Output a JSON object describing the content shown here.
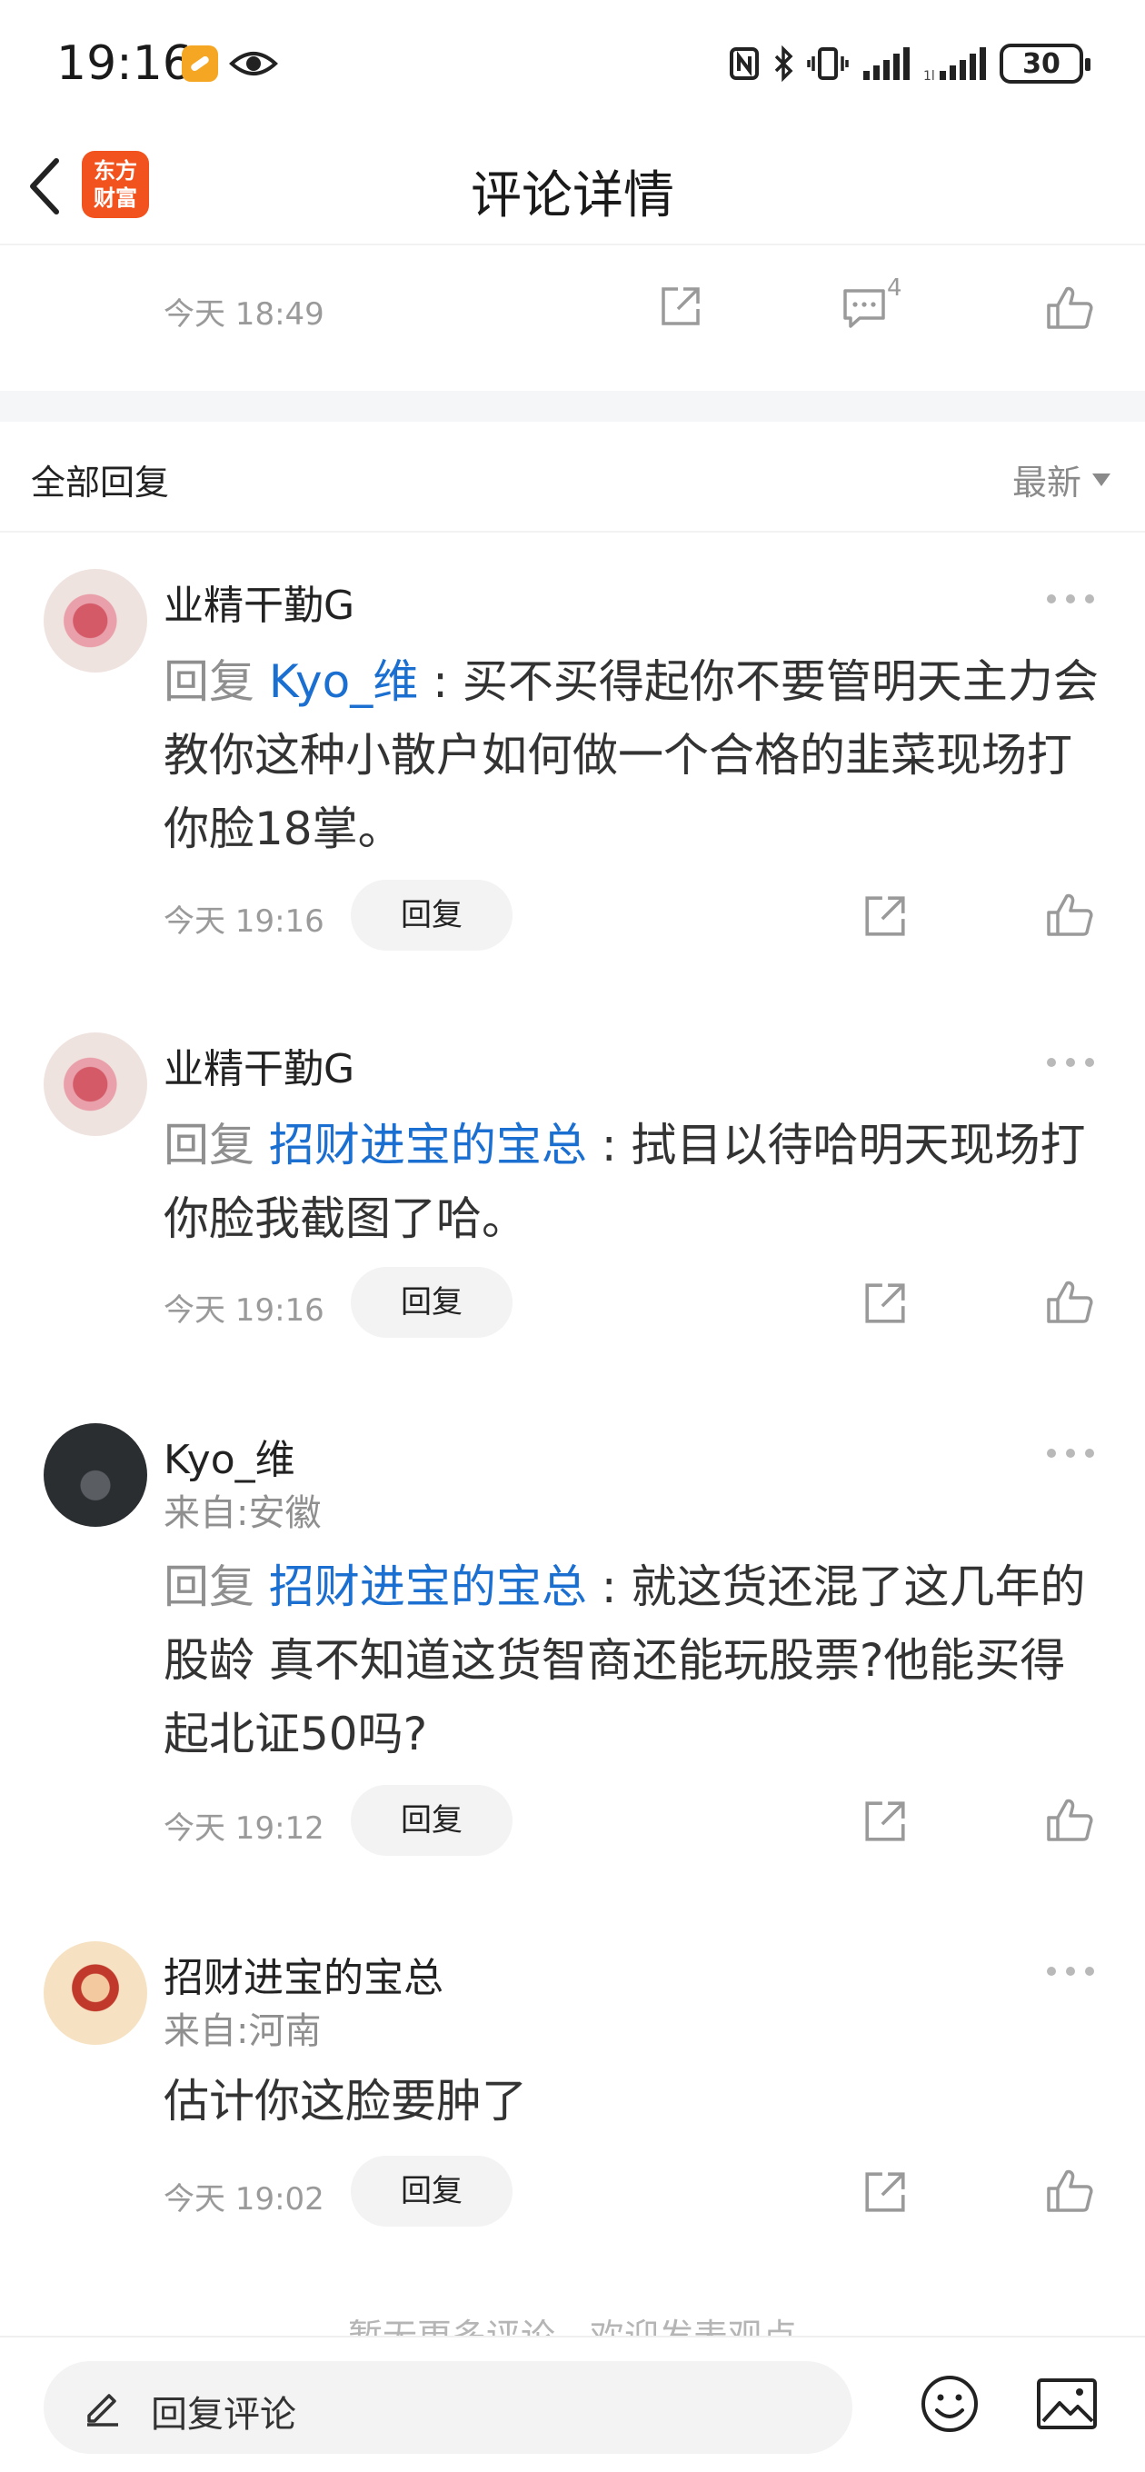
{
  "status_bar": {
    "time": "19:16",
    "battery": "30"
  },
  "header": {
    "logo_line1": "东方",
    "logo_line2": "财富",
    "title": "评论详情"
  },
  "top_comment": {
    "time": "今天 18:49",
    "comment_count": "4"
  },
  "replies_section": {
    "title": "全部回复",
    "sort": "最新"
  },
  "replies": [
    {
      "name": "业精干勤G",
      "location": "",
      "reply_prefix": "回复 ",
      "reply_to": "Kyo_维",
      "text": " : 买不买得起你不要管明天主力会教你这种小散户如何做一个合格的韭菜现场打你脸18掌。",
      "time": "今天 19:16",
      "reply_label": "回复"
    },
    {
      "name": "业精干勤G",
      "location": "",
      "reply_prefix": "回复 ",
      "reply_to": "招财进宝的宝总",
      "text": " : 拭目以待哈明天现场打你脸我截图了哈。",
      "time": "今天 19:16",
      "reply_label": "回复"
    },
    {
      "name": "Kyo_维",
      "location": "来自:安徽",
      "reply_prefix": "回复 ",
      "reply_to": "招财进宝的宝总",
      "text": " : 就这货还混了这几年的股龄 真不知道这货智商还能玩股票?他能买得起北证50吗?",
      "time": "今天 19:12",
      "reply_label": "回复"
    },
    {
      "name": "招财进宝的宝总",
      "location": "来自:河南",
      "reply_prefix": "",
      "reply_to": "",
      "text": "估计你这脸要肿了",
      "time": "今天 19:02",
      "reply_label": "回复"
    }
  ],
  "footer_note": "暂无更多评论，欢迎发表观点",
  "bottom_bar": {
    "input_placeholder": "回复评论"
  },
  "colors": {
    "accent_link": "#1a6fd1",
    "logo_bg": "#f2531e",
    "muted": "#9a9a9a"
  },
  "icons": [
    "back-icon",
    "share-icon",
    "comment-icon",
    "like-icon",
    "more-icon",
    "pencil-icon",
    "emoji-icon",
    "image-icon",
    "eye-icon",
    "nfc-icon",
    "bluetooth-icon",
    "vibrate-icon",
    "signal-icon",
    "battery-icon"
  ]
}
